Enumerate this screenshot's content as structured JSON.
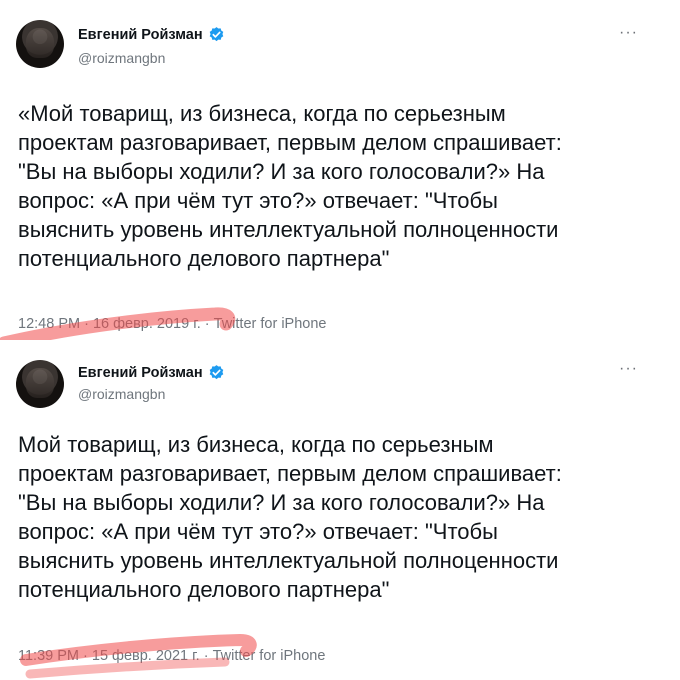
{
  "tweets": [
    {
      "author_name": "Евгений Ройзман",
      "handle": "@roizmangbn",
      "more_label": "···",
      "text_lines": [
        "«Мой товарищ, из бизнеса, когда по серьезным",
        "проектам разговаривает, первым делом спрашивает:",
        "\"Вы на выборы ходили? И за кого голосовали?» На",
        "вопрос: «А при чём тут это?»   отвечает:  \"Чтобы",
        "выяснить уровень интеллектуальной полноценности",
        "потенциального делового партнера\""
      ],
      "timestamp": "12:48 PM · 16 февр. 2019 г. · Twitter for iPhone"
    },
    {
      "author_name": "Евгений Ройзман",
      "handle": "@roizmangbn",
      "more_label": "···",
      "text_lines": [
        "Мой товарищ, из бизнеса, когда по серьезным",
        "проектам разговаривает, первым делом спрашивает:",
        "\"Вы на выборы ходили? И за кого голосовали?» На",
        "вопрос: «А при чём тут это?»   отвечает:  \"Чтобы",
        "выяснить уровень интеллектуальной полноценности",
        "потенциального делового партнера\""
      ],
      "timestamp": "11:39 PM · 15 февр. 2021 г. · Twitter for iPhone"
    }
  ],
  "colors": {
    "verified_badge": "#1d9bf0",
    "highlight": "#f04a4a"
  },
  "icons": {
    "verified": "verified-badge-icon",
    "more": "more-options-icon"
  }
}
